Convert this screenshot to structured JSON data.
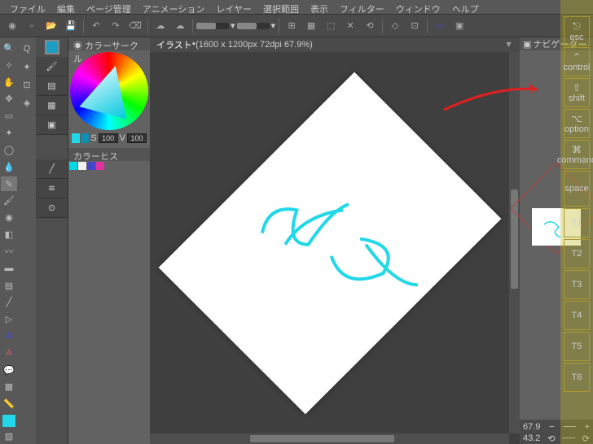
{
  "menu": [
    "ファイル",
    "編集",
    "ページ管理",
    "アニメーション",
    "レイヤー",
    "選択範囲",
    "表示",
    "フィルター",
    "ウィンドウ",
    "ヘルプ"
  ],
  "canvas": {
    "title": "イラスト*",
    "info": "(1600 x 1200px 72dpi 67.9%)"
  },
  "panels": {
    "colorCircle": "カラーサークル",
    "colorHistory": "カラーヒス",
    "navigator": "ナビゲーター"
  },
  "colorvals": {
    "s_label": "S",
    "s": "100",
    "v_label": "V",
    "v": "100"
  },
  "nav": {
    "zoom": "67.9",
    "angle": "43.2"
  },
  "keys": [
    {
      "sym": "⎋",
      "label": "esc"
    },
    {
      "sym": "⌃",
      "label": "control"
    },
    {
      "sym": "⇧",
      "label": "shift"
    },
    {
      "sym": "⌥",
      "label": "option"
    },
    {
      "sym": "⌘",
      "label": "command"
    },
    {
      "sym": "",
      "label": "space"
    },
    {
      "sym": "",
      "label": "T1"
    },
    {
      "sym": "",
      "label": "T2"
    },
    {
      "sym": "",
      "label": "T3"
    },
    {
      "sym": "",
      "label": "T4"
    },
    {
      "sym": "",
      "label": "T5"
    },
    {
      "sym": "",
      "label": "T6"
    }
  ],
  "topIcons": [
    "zoom",
    "new",
    "open",
    "save",
    "undo",
    "redo",
    "erase",
    "cloud",
    "cloud2"
  ],
  "tools": [
    "zoom",
    "move",
    "hand",
    "select",
    "lasso",
    "wand",
    "crop",
    "eyedrop",
    "pen",
    "brush",
    "spray",
    "eraser",
    "blend",
    "fill",
    "grad",
    "text",
    "balloon",
    "ruler",
    "frame"
  ]
}
